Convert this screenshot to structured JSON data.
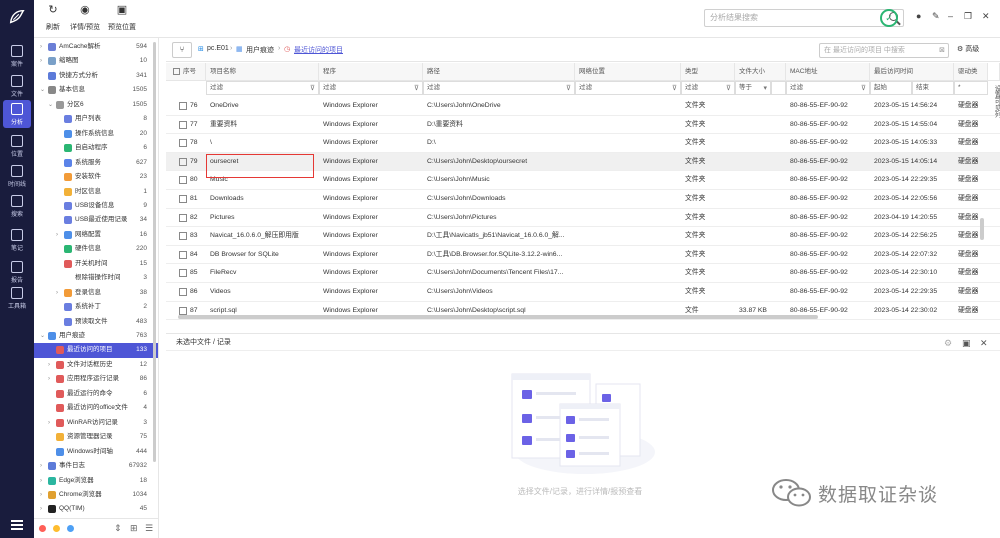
{
  "toolbar": {
    "refresh": "刷新",
    "detail_preview": "详情/预览",
    "preview_pos": "预览位置",
    "search_placeholder": "分析结果搜索"
  },
  "rail": [
    "案件",
    "文件",
    "分析",
    "位置",
    "时间线",
    "搜索",
    "笔记",
    "报告",
    "工具箱"
  ],
  "tree": [
    {
      "label": "AmCache解析",
      "count": "594",
      "indent": 1,
      "arrow": "›",
      "color": "#6b7fd6"
    },
    {
      "label": "缩略图",
      "count": "10",
      "indent": 1,
      "arrow": "›",
      "color": "#7aa0c8"
    },
    {
      "label": "快捷方式分析",
      "count": "341",
      "indent": 1,
      "arrow": "",
      "color": "#5c7bd9"
    },
    {
      "label": "基本信息",
      "count": "1505",
      "indent": 1,
      "arrow": "⌄",
      "color": "#888"
    },
    {
      "label": "分区6",
      "count": "1505",
      "indent": 2,
      "arrow": "⌄",
      "color": "#999"
    },
    {
      "label": "用户列表",
      "count": "8",
      "indent": 3,
      "arrow": "",
      "color": "#6a7ee0"
    },
    {
      "label": "操作系统信息",
      "count": "20",
      "indent": 3,
      "arrow": "",
      "color": "#4e8fe8"
    },
    {
      "label": "自启动程序",
      "count": "6",
      "indent": 3,
      "arrow": "",
      "color": "#2bb673"
    },
    {
      "label": "系统服务",
      "count": "627",
      "indent": 3,
      "arrow": "",
      "color": "#5b83e8"
    },
    {
      "label": "安装软件",
      "count": "23",
      "indent": 3,
      "arrow": "",
      "color": "#f29b38"
    },
    {
      "label": "时区信息",
      "count": "1",
      "indent": 3,
      "arrow": "",
      "color": "#f2b138"
    },
    {
      "label": "USB设备信息",
      "count": "9",
      "indent": 3,
      "arrow": "",
      "color": "#6a7ee0"
    },
    {
      "label": "USB最近使用记录",
      "count": "34",
      "indent": 3,
      "arrow": "",
      "color": "#6a7ee0"
    },
    {
      "label": "网络配置",
      "count": "16",
      "indent": 3,
      "arrow": "›",
      "color": "#4e8fe8"
    },
    {
      "label": "硬件信息",
      "count": "220",
      "indent": 3,
      "arrow": "",
      "color": "#2bb673"
    },
    {
      "label": "开关机时间",
      "count": "15",
      "indent": 3,
      "arrow": "",
      "color": "#e05a5a"
    },
    {
      "label": "根除错操作时间",
      "count": "3",
      "indent": 3,
      "arrow": "",
      "color": "#ffffff"
    },
    {
      "label": "登录信息",
      "count": "38",
      "indent": 3,
      "arrow": "›",
      "color": "#f29b38"
    },
    {
      "label": "系统补丁",
      "count": "2",
      "indent": 3,
      "arrow": "",
      "color": "#6a7ee0"
    },
    {
      "label": "预读取文件",
      "count": "483",
      "indent": 3,
      "arrow": "",
      "color": "#6a7ee0"
    },
    {
      "label": "用户痕迹",
      "count": "763",
      "indent": 1,
      "arrow": "⌄",
      "color": "#4e8fe8"
    },
    {
      "label": "最近访问的项目",
      "count": "133",
      "indent": 2,
      "arrow": "",
      "color": "#e05a5a",
      "selected": true
    },
    {
      "label": "文件对话框历史",
      "count": "12",
      "indent": 2,
      "arrow": "›",
      "color": "#e05a5a"
    },
    {
      "label": "应用程序运行记录",
      "count": "86",
      "indent": 2,
      "arrow": "›",
      "color": "#e05a5a"
    },
    {
      "label": "最近运行的命令",
      "count": "6",
      "indent": 2,
      "arrow": "",
      "color": "#e05a5a"
    },
    {
      "label": "最近访问的office文件",
      "count": "4",
      "indent": 2,
      "arrow": "",
      "color": "#e05a5a"
    },
    {
      "label": "WinRAR访问记录",
      "count": "3",
      "indent": 2,
      "arrow": "›",
      "color": "#e05a5a"
    },
    {
      "label": "资源管理器记录",
      "count": "75",
      "indent": 2,
      "arrow": "",
      "color": "#f2b138"
    },
    {
      "label": "Windows时间轴",
      "count": "444",
      "indent": 2,
      "arrow": "",
      "color": "#4e8fe8"
    },
    {
      "label": "事件日志",
      "count": "67932",
      "indent": 1,
      "arrow": "›",
      "color": "#5c7bd9"
    },
    {
      "label": "Edge浏览器",
      "count": "18",
      "indent": 1,
      "arrow": "›",
      "color": "#2bb6a0"
    },
    {
      "label": "Chrome浏览器",
      "count": "1034",
      "indent": 1,
      "arrow": "›",
      "color": "#e0a030"
    },
    {
      "label": "QQ(TIM)",
      "count": "45",
      "indent": 1,
      "arrow": "›",
      "color": "#222"
    }
  ],
  "breadcrumb": {
    "c1": "pc.E01",
    "c2": "用户痕迹",
    "c3": "最近访问的项目",
    "filter_placeholder": "在 最近访问的项目 中搜索",
    "advanced": "高级"
  },
  "columns": {
    "seq": "序号",
    "name": "项目名称",
    "program": "程序",
    "path": "路径",
    "netloc": "网络位置",
    "type": "类型",
    "size": "文件大小",
    "mac": "MAC地址",
    "last": "最后访问时间",
    "drive": "驱动类"
  },
  "filters": {
    "text": "过滤",
    "eq": "等于",
    "start": "起始",
    "end": "结束",
    "star": "*"
  },
  "rows": [
    {
      "seq": "76",
      "name": "OneDrive",
      "program": "Windows Explorer",
      "path": "C:\\Users\\John\\OneDrive",
      "type": "文件夹",
      "size": "",
      "mac": "80-86-55-EF-90-92",
      "last": "2023-05-15 14:56:24",
      "drive": "硬盘器"
    },
    {
      "seq": "77",
      "name": "重要资料",
      "program": "Windows Explorer",
      "path": "D:\\重要资料",
      "type": "文件夹",
      "size": "",
      "mac": "80-86-55-EF-90-92",
      "last": "2023-05-15 14:55:04",
      "drive": "硬盘器"
    },
    {
      "seq": "78",
      "name": "\\",
      "program": "Windows Explorer",
      "path": "D:\\",
      "type": "文件夹",
      "size": "",
      "mac": "80-86-55-EF-90-92",
      "last": "2023-05-15 14:05:33",
      "drive": "硬盘器"
    },
    {
      "seq": "79",
      "name": "oursecret",
      "program": "Windows Explorer",
      "path": "C:\\Users\\John\\Desktop\\oursecret",
      "type": "文件夹",
      "size": "",
      "mac": "80-86-55-EF-90-92",
      "last": "2023-05-15 14:05:14",
      "drive": "硬盘器",
      "selected": true
    },
    {
      "seq": "80",
      "name": "Music",
      "program": "Windows Explorer",
      "path": "C:\\Users\\John\\Music",
      "type": "文件夹",
      "size": "",
      "mac": "80-86-55-EF-90-92",
      "last": "2023-05-14 22:29:35",
      "drive": "硬盘器"
    },
    {
      "seq": "81",
      "name": "Downloads",
      "program": "Windows Explorer",
      "path": "C:\\Users\\John\\Downloads",
      "type": "文件夹",
      "size": "",
      "mac": "80-86-55-EF-90-92",
      "last": "2023-05-14 22:05:56",
      "drive": "硬盘器"
    },
    {
      "seq": "82",
      "name": "Pictures",
      "program": "Windows Explorer",
      "path": "C:\\Users\\John\\Pictures",
      "type": "文件夹",
      "size": "",
      "mac": "80-86-55-EF-90-92",
      "last": "2023-04-19 14:20:55",
      "drive": "硬盘器"
    },
    {
      "seq": "83",
      "name": "Navicat_16.0.6.0_解压即用版",
      "program": "Windows Explorer",
      "path": "D:\\工具\\Navicatls_jb51\\Navicat_16.0.6.0_解...",
      "type": "文件夹",
      "size": "",
      "mac": "80-86-55-EF-90-92",
      "last": "2023-05-14 22:56:25",
      "drive": "硬盘器"
    },
    {
      "seq": "84",
      "name": "DB Browser for SQLite",
      "program": "Windows Explorer",
      "path": "D:\\工具\\DB.Browser.for.SQLite-3.12.2-win6...",
      "type": "文件夹",
      "size": "",
      "mac": "80-86-55-EF-90-92",
      "last": "2023-05-14 22:07:32",
      "drive": "硬盘器"
    },
    {
      "seq": "85",
      "name": "FileRecv",
      "program": "Windows Explorer",
      "path": "C:\\Users\\John\\Documents\\Tencent Files\\17...",
      "type": "文件夹",
      "size": "",
      "mac": "80-86-55-EF-90-92",
      "last": "2023-05-14 22:30:10",
      "drive": "硬盘器"
    },
    {
      "seq": "86",
      "name": "Videos",
      "program": "Windows Explorer",
      "path": "C:\\Users\\John\\Videos",
      "type": "文件夹",
      "size": "",
      "mac": "80-86-55-EF-90-92",
      "last": "2023-05-14 22:29:35",
      "drive": "硬盘器"
    },
    {
      "seq": "87",
      "name": "script.sql",
      "program": "Windows Explorer",
      "path": "C:\\Users\\John\\Desktop\\script.sql",
      "type": "文件",
      "size": "33.87 KB",
      "mac": "80-86-55-EF-90-92",
      "last": "2023-05-14 22:30:02",
      "drive": "硬盘器"
    }
  ],
  "side_vertical": "设置可见列",
  "detail": {
    "title": "未选中文件 / 记录",
    "empty_hint": "选择文件/记录，进行详情/报预查看"
  },
  "watermark": "数据取证杂谈"
}
